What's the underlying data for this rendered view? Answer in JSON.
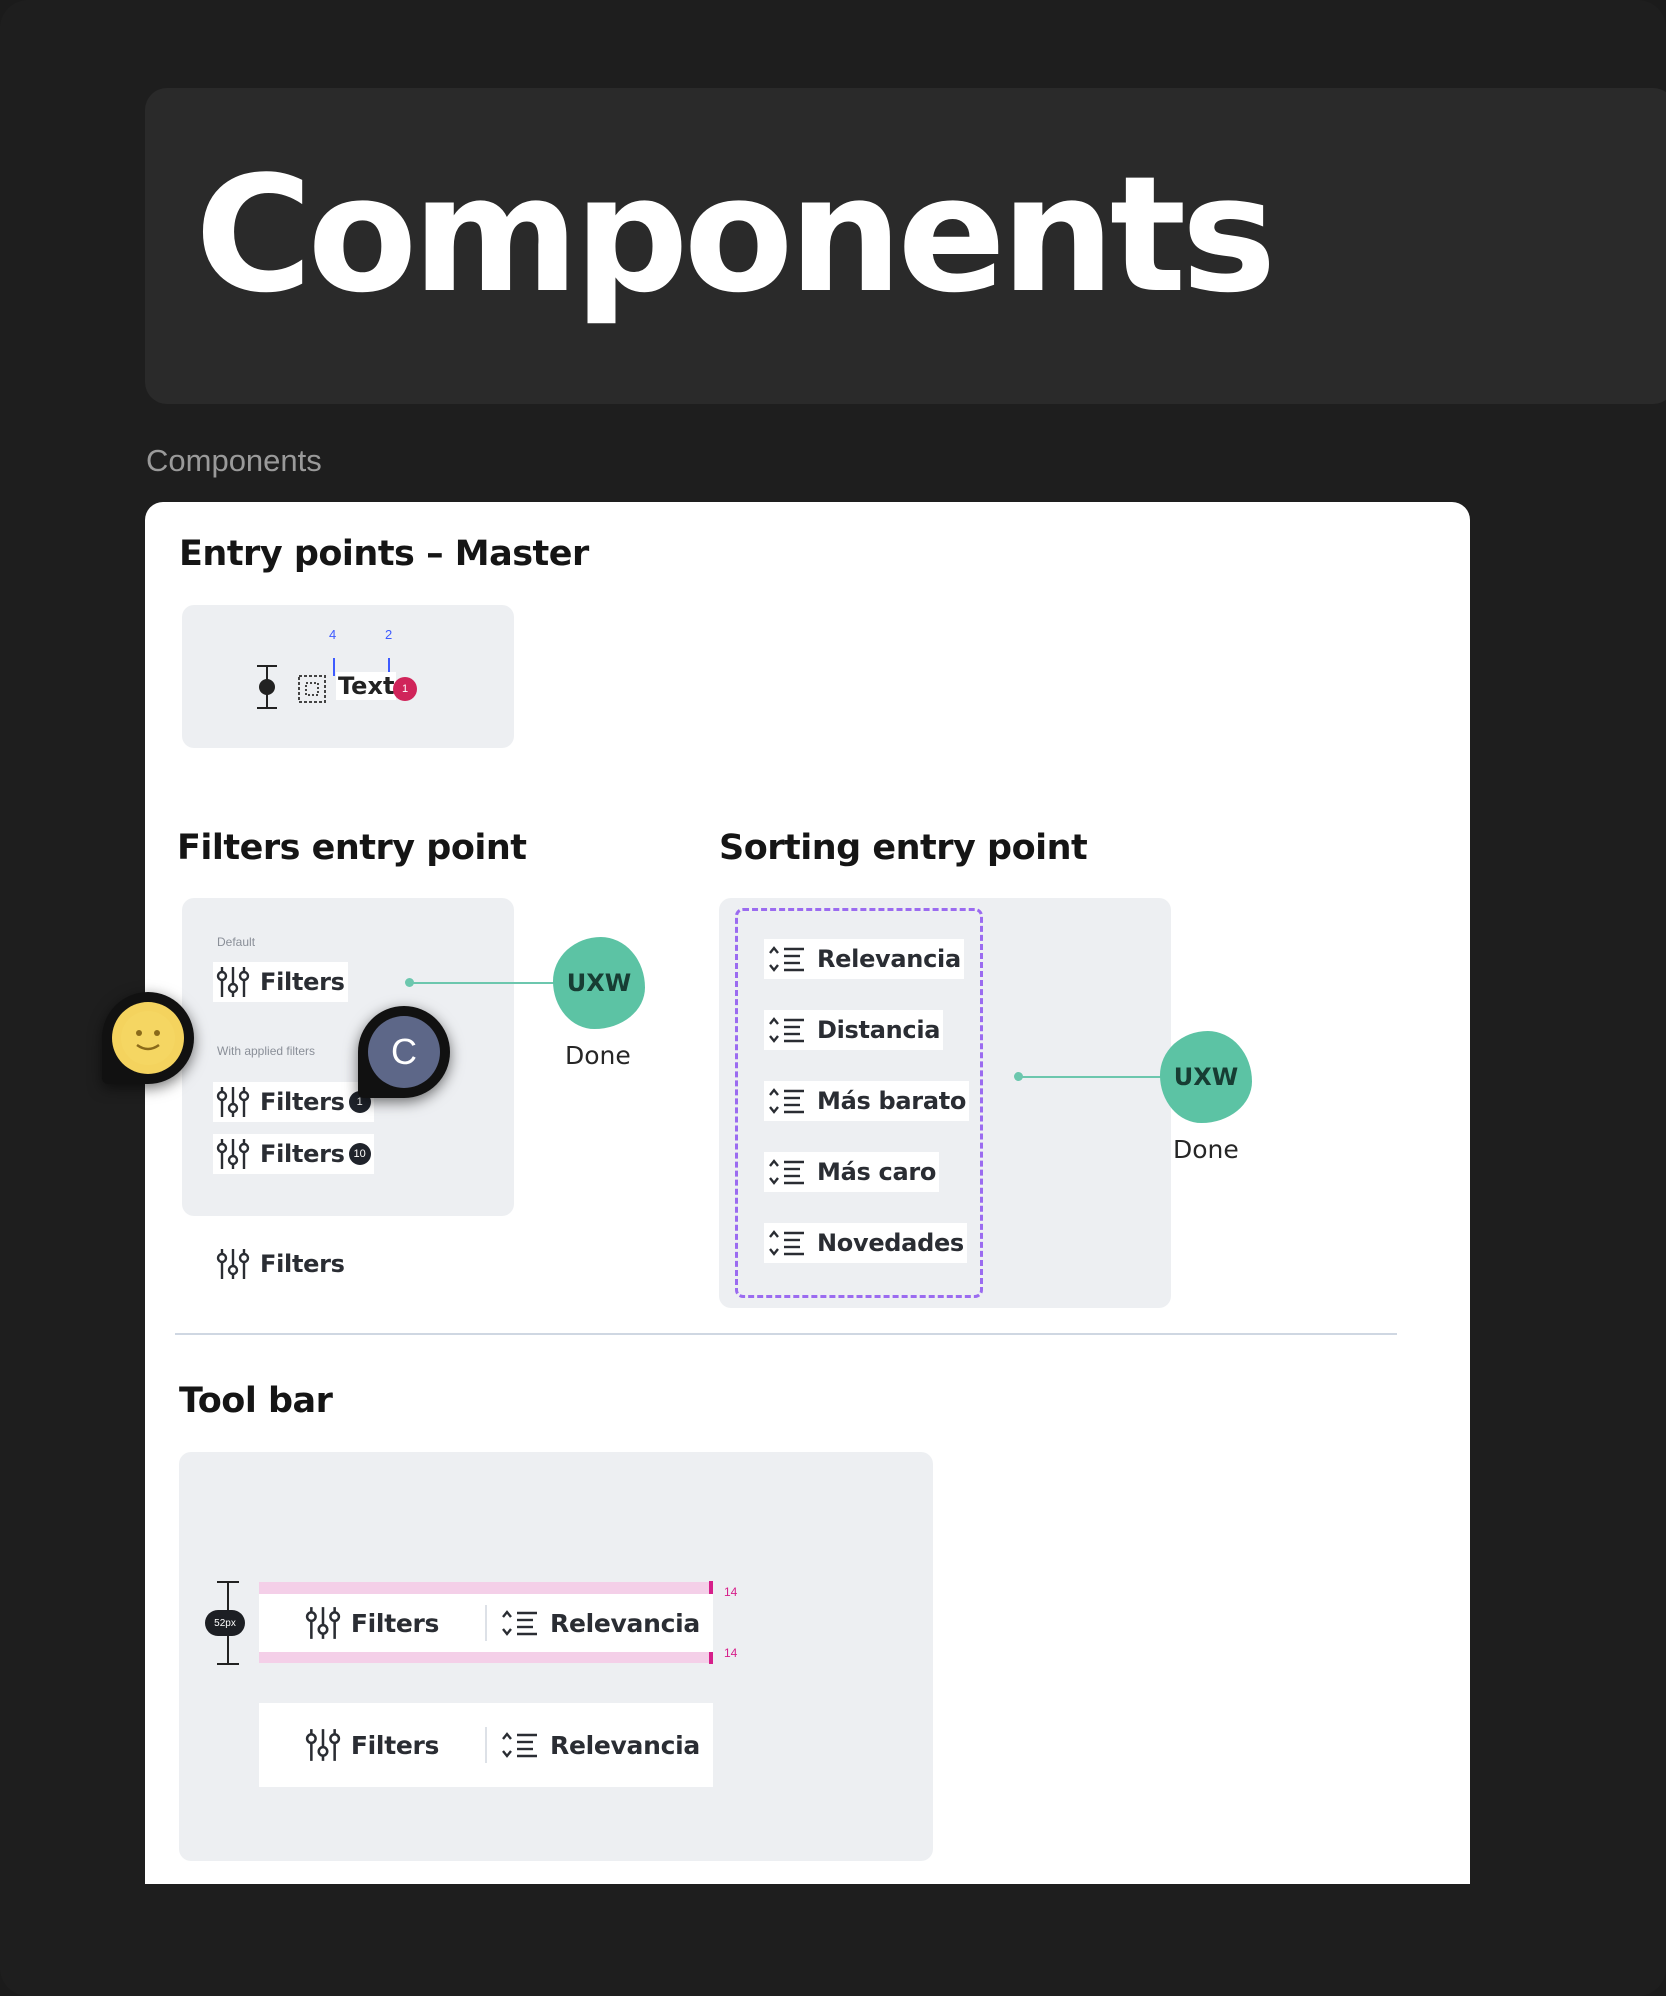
{
  "page": {
    "title": "Components",
    "frame_label": "Components"
  },
  "entry_master": {
    "title": "Entry points – Master",
    "spacing_left": "4",
    "spacing_right": "2",
    "text_label": "Text",
    "badge": "1"
  },
  "filters_entry": {
    "title": "Filters entry point",
    "default_caption": "Default",
    "applied_caption": "With applied filters",
    "label": "Filters",
    "badge_small": "1",
    "badge_large": "10",
    "annotation_initials": "UXW",
    "annotation_status": "Done"
  },
  "sorting_entry": {
    "title": "Sorting entry point",
    "options": [
      "Relevancia",
      "Distancia",
      "Más barato",
      "Más caro",
      "Novedades"
    ],
    "annotation_initials": "UXW",
    "annotation_status": "Done"
  },
  "toolbar": {
    "title": "Tool bar",
    "filters_label": "Filters",
    "sort_label": "Relevancia",
    "padding_top": "14",
    "padding_bottom": "14",
    "height_label": "52px"
  },
  "collaborators": {
    "second_initial": "C"
  },
  "colors": {
    "accent_green": "#5cc3a4",
    "badge_red": "#d0245a",
    "dashed_purple": "#9b6bf0",
    "spacing_pink": "#d61f8a",
    "spacing_blue": "#3e5bff"
  },
  "icons": [
    "sliders-icon",
    "sort-icon",
    "spacing-icon",
    "dashed-square-icon",
    "smiley-avatar-icon"
  ]
}
